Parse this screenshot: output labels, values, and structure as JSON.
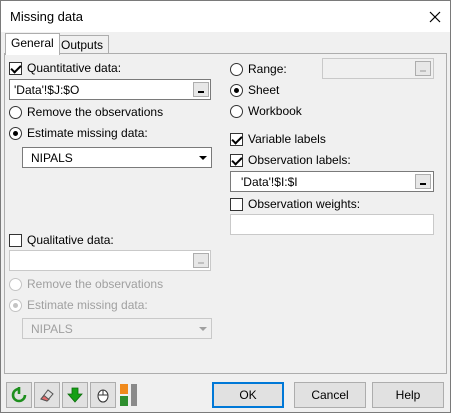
{
  "window": {
    "title": "Missing data",
    "close_glyph": "✕"
  },
  "tabs": [
    {
      "label": "General",
      "active": true
    },
    {
      "label": "Outputs",
      "active": false
    }
  ],
  "quantitative": {
    "label": "Quantitative data:",
    "checked": true,
    "value": "'Data'!$J:$O",
    "remove_label": "Remove the observations",
    "estimate_label": "Estimate missing data:",
    "method": "NIPALS"
  },
  "qualitative": {
    "label": "Qualitative data:",
    "checked": false,
    "value": "",
    "remove_label": "Remove the observations",
    "estimate_label": "Estimate missing data:",
    "method": "NIPALS"
  },
  "output_location": {
    "range_label": "Range:",
    "sheet_label": "Sheet",
    "workbook_label": "Workbook",
    "selected": "sheet",
    "range_value": ""
  },
  "options": {
    "variable_labels": "Variable labels",
    "variable_labels_checked": true,
    "observation_labels": "Observation labels:",
    "observation_labels_checked": true,
    "observation_labels_value": "'Data'!$I:$I",
    "observation_weights": "Observation weights:",
    "observation_weights_checked": false,
    "observation_weights_value": ""
  },
  "footer": {
    "icons": [
      "reset-icon",
      "eraser-icon",
      "download-icon",
      "mouse-icon",
      "toggle-icon"
    ],
    "ok_label": "OK",
    "cancel_label": "Cancel",
    "help_label": "Help"
  },
  "colors": {
    "reset_green": "#1e8f1e",
    "arrow_green": "#14a014",
    "accent_blue": "#0078d7"
  }
}
